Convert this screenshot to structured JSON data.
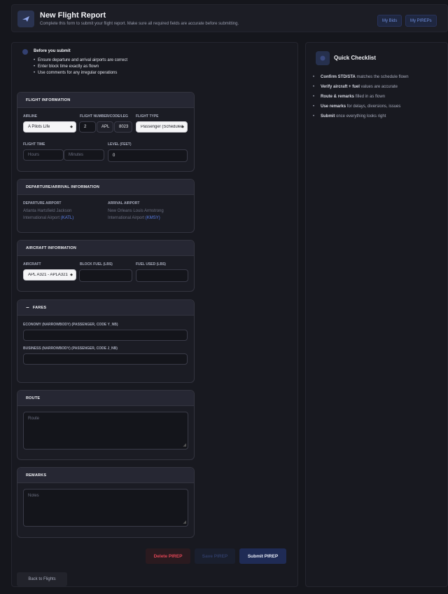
{
  "header": {
    "title": "New Flight Report",
    "subtitle": "Complete this form to submit your flight report. Make sure all required fields are accurate before submitting.",
    "btn_bids": "My Bids",
    "btn_pireps": "My PIREPs"
  },
  "note": {
    "title": "Before you submit",
    "items": [
      "Ensure departure and arrival airports are correct",
      "Enter block time exactly as flown",
      "Use comments for any irregular operations"
    ]
  },
  "flight_info": {
    "title": "FLIGHT INFORMATION",
    "airline_label": "AIRLINE",
    "airline_value": "A Pilots Life",
    "flight_number_label": "FLIGHT NUMBER/CODE/LEG",
    "flight_number": "2",
    "flight_code": "APL",
    "flight_leg": "8023",
    "flight_type_label": "FLIGHT TYPE",
    "flight_type_value": "Passenger (Scheduled)",
    "flight_time_label": "FLIGHT TIME",
    "hours_placeholder": "Hours",
    "minutes_placeholder": "Minutes",
    "level_label": "LEVEL (FEET)",
    "level_value": "0"
  },
  "dep_arr": {
    "title": "DEPARTURE/ARRIVAL INFORMATION",
    "dep_label": "DEPARTURE AIRPORT",
    "dep_name_1": "Atlanta Hartsfield Jackson",
    "dep_name_2": "International Airport",
    "dep_code": "(KATL)",
    "arr_label": "ARRIVAL AIRPORT",
    "arr_name_1": "New Orleans Louis Armstrong",
    "arr_name_2": "International Airport",
    "arr_code": "(KMSY)"
  },
  "aircraft": {
    "title": "AIRCRAFT INFORMATION",
    "aircraft_label": "AIRCRAFT",
    "aircraft_value": "APL A321 - APLA321",
    "block_fuel_label": "BLOCK FUEL (LBS)",
    "fuel_used_label": "FUEL USED (LBS)"
  },
  "fares": {
    "toggle": "−",
    "title": "FARES",
    "economy_label": "ECONOMY (NARROWBODY) (PASSENGER, CODE Y_NB)",
    "business_label": "BUSINESS (NARROWBODY) (PASSENGER, CODE J_NB)"
  },
  "route": {
    "title": "ROUTE",
    "placeholder": "Route"
  },
  "remarks": {
    "title": "REMARKS",
    "placeholder": "Notes"
  },
  "actions": {
    "delete": "Delete PIREP",
    "save": "Save PIREP",
    "submit": "Submit PIREP",
    "back": "Back to Flights"
  },
  "checklist": {
    "title": "Quick Checklist",
    "items": [
      {
        "bold": "Confirm STD/STA",
        "rest": " matches the schedule flown"
      },
      {
        "bold": "Verify aircraft + fuel",
        "rest": " values are accurate"
      },
      {
        "bold": "Route & remarks",
        "rest": " filled in as flown"
      },
      {
        "bold": "Use remarks",
        "rest": " for delays, diversions, issues"
      },
      {
        "bold": "Submit",
        "rest": " once everything looks right"
      }
    ]
  },
  "colors": {
    "accent": "#5a7fe8",
    "danger": "#e04555",
    "background": "#15161c"
  }
}
